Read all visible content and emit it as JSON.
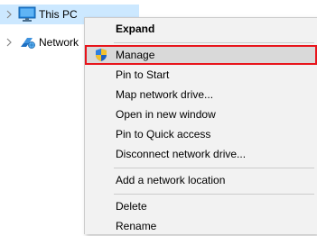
{
  "nav": {
    "items": [
      {
        "label": "This PC",
        "icon": "computer-icon",
        "selected": true
      },
      {
        "label": "Network",
        "icon": "network-icon",
        "selected": false
      }
    ]
  },
  "context_menu": {
    "items": [
      {
        "label": "Expand",
        "bold": true
      },
      {
        "label": "Manage",
        "icon": "uac-shield-icon",
        "highlighted": true
      },
      {
        "label": "Pin to Start"
      },
      {
        "label": "Map network drive..."
      },
      {
        "label": "Open in new window"
      },
      {
        "label": "Pin to Quick access"
      },
      {
        "label": "Disconnect network drive..."
      },
      {
        "label": "Add a network location"
      },
      {
        "label": "Delete"
      },
      {
        "label": "Rename"
      }
    ]
  },
  "colors": {
    "selection": "#cce8ff",
    "menu_background": "#f2f2f2",
    "highlight_border": "#e8141b",
    "hover": "#d9d9d9"
  }
}
